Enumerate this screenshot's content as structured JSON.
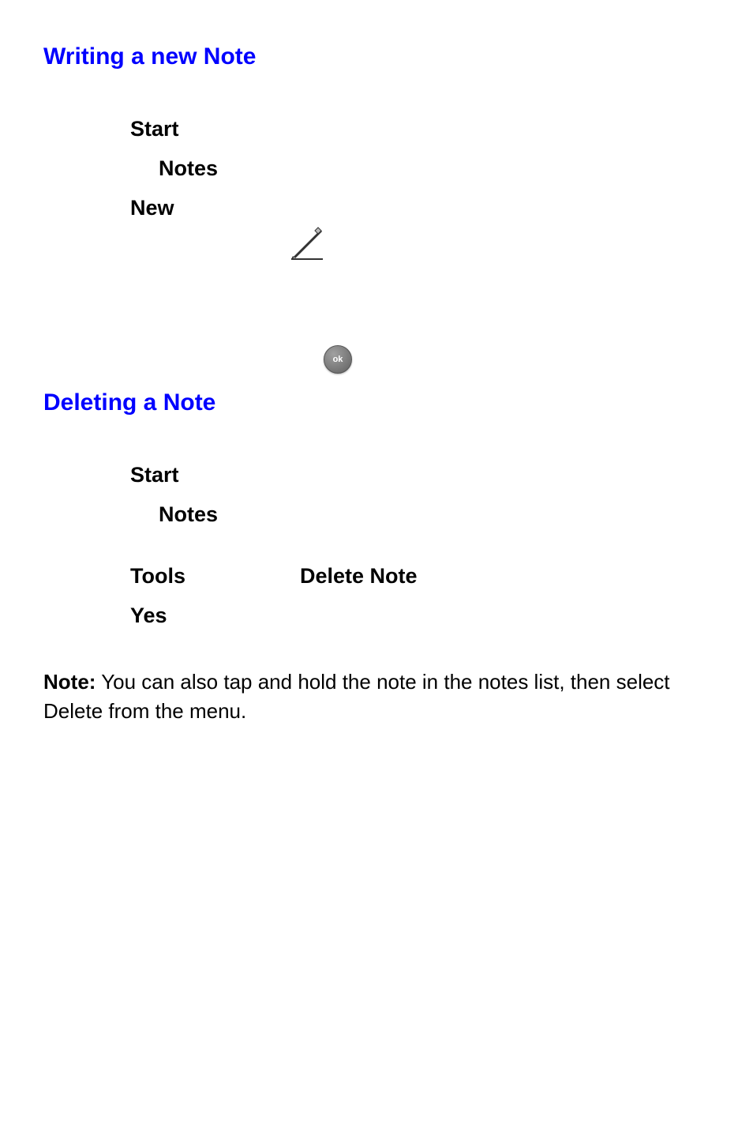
{
  "section1": {
    "heading": "Writing a new Note",
    "items": {
      "start": "Start",
      "notes": "Notes",
      "new": "New"
    }
  },
  "icons": {
    "pen": "pen-icon",
    "ok": "ok"
  },
  "section2": {
    "heading": "Deleting a Note",
    "items": {
      "start": "Start",
      "notes": "Notes",
      "tools": "Tools",
      "deleteNote": "Delete Note",
      "yes": "Yes"
    }
  },
  "note": {
    "label": "Note:",
    "text": " You can also tap and hold the note in the notes list, then select Delete from the menu."
  }
}
